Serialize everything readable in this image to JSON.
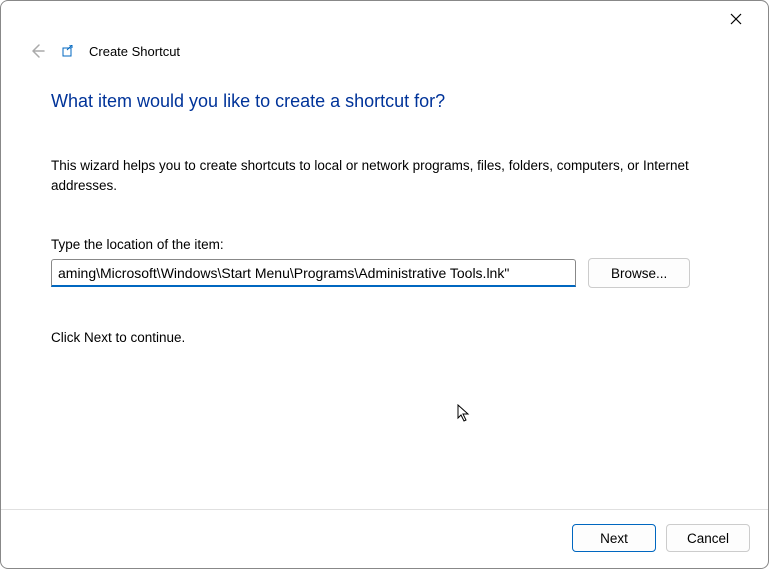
{
  "header": {
    "title": "Create Shortcut"
  },
  "main": {
    "heading": "What item would you like to create a shortcut for?",
    "description": "This wizard helps you to create shortcuts to local or network programs, files, folders, computers, or Internet addresses.",
    "input_label": "Type the location of the item:",
    "input_value": "aming\\Microsoft\\Windows\\Start Menu\\Programs\\Administrative Tools.lnk\"",
    "browse_label": "Browse...",
    "continue_text": "Click Next to continue."
  },
  "footer": {
    "next_label": "Next",
    "cancel_label": "Cancel"
  }
}
